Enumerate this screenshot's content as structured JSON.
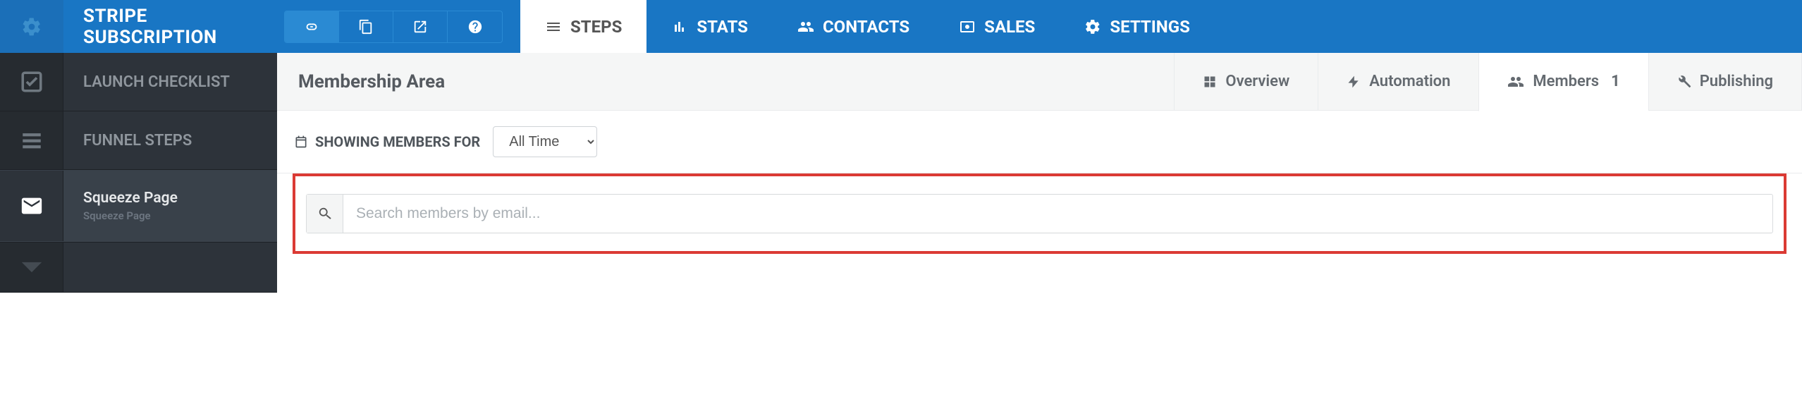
{
  "topbar": {
    "title": "STRIPE SUBSCRIPTION",
    "nav": {
      "steps": "STEPS",
      "stats": "STATS",
      "contacts": "CONTACTS",
      "sales": "SALES",
      "settings": "SETTINGS"
    }
  },
  "sidebar": {
    "launch_checklist": "LAUNCH CHECKLIST",
    "funnel_steps": "FUNNEL STEPS",
    "squeeze_title": "Squeeze Page",
    "squeeze_sub": "Squeeze Page"
  },
  "content": {
    "title": "Membership Area",
    "tabs": {
      "overview": "Overview",
      "automation": "Automation",
      "members": "Members",
      "members_count": "1",
      "publishing": "Publishing"
    },
    "filter_label": "SHOWING MEMBERS FOR",
    "filter_selected": "All Time",
    "search_placeholder": "Search members by email..."
  }
}
